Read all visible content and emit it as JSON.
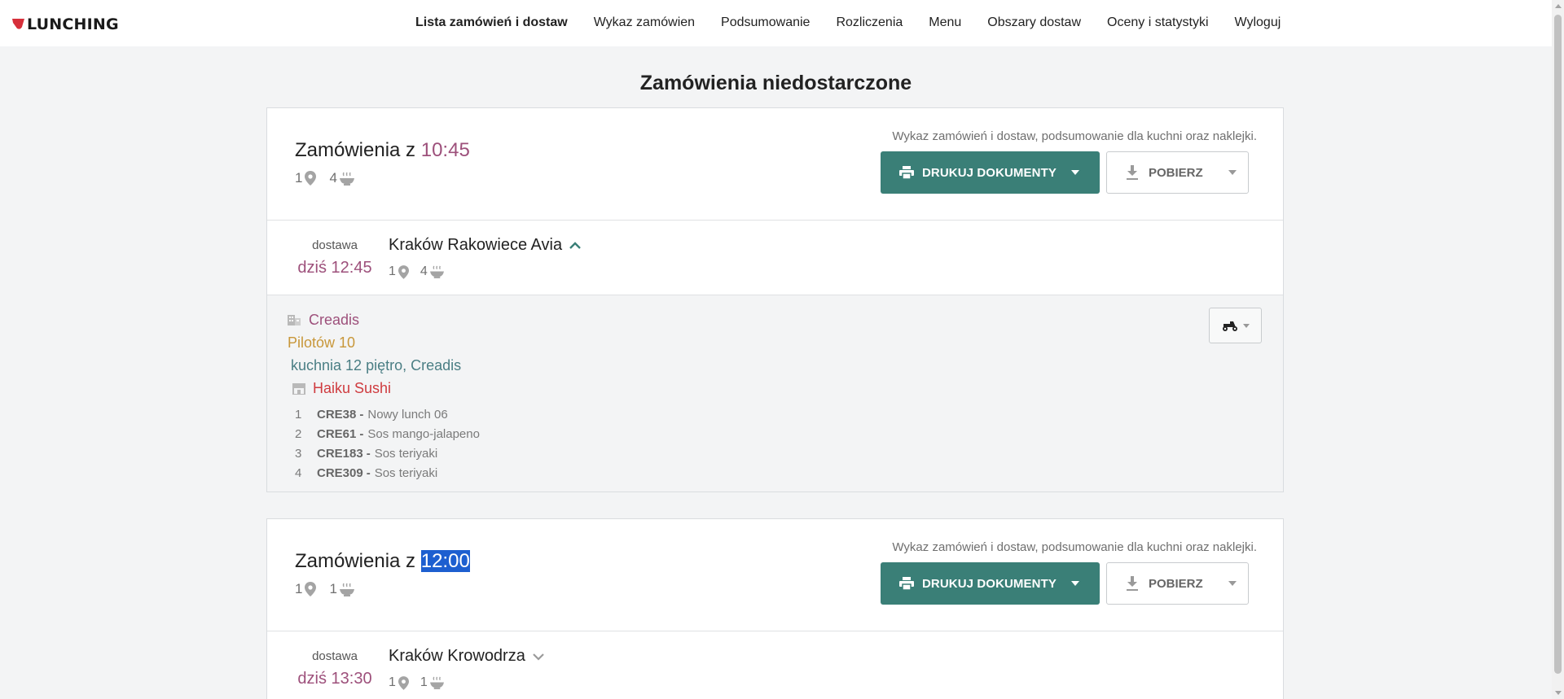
{
  "brand": {
    "logo_text": "LUNCHING",
    "logo_color": "#d62f3a"
  },
  "nav": {
    "items": [
      {
        "label": "Lista zamówień i dostaw",
        "active": true
      },
      {
        "label": "Wykaz zamówien",
        "active": false
      },
      {
        "label": "Podsumowanie",
        "active": false
      },
      {
        "label": "Rozliczenia",
        "active": false
      },
      {
        "label": "Menu",
        "active": false
      },
      {
        "label": "Obszary dostaw",
        "active": false
      },
      {
        "label": "Oceny i statystyki",
        "active": false
      },
      {
        "label": "Wyloguj",
        "active": false
      }
    ]
  },
  "page": {
    "title": "Zamówienia niedostarczone"
  },
  "sections": [
    {
      "title_prefix": "Zamówienia z",
      "time": "10:45",
      "time_selected": false,
      "locations_count": "1",
      "meals_count": "4",
      "info": "Wykaz zamówień i dostaw, podsumowanie dla kuchni oraz naklejki.",
      "print_label": "DRUKUJ DOKUMENTY",
      "download_label": "POBIERZ",
      "delivery": {
        "label": "dostawa",
        "time": "dziś 12:45",
        "place": "Kraków Rakowiece Avia",
        "expanded": true,
        "locations_count": "1",
        "meals_count": "4",
        "company": "Creadis",
        "street": "Pilotów 10",
        "note": "kuchnia 12 piętro, Creadis",
        "restaurant": "Haiku Sushi",
        "items": [
          {
            "no": "1",
            "code": "CRE38",
            "name": "Nowy lunch 06"
          },
          {
            "no": "2",
            "code": "CRE61",
            "name": "Sos mango-jalapeno"
          },
          {
            "no": "3",
            "code": "CRE183",
            "name": "Sos teriyaki"
          },
          {
            "no": "4",
            "code": "CRE309",
            "name": "Sos teriyaki"
          }
        ]
      }
    },
    {
      "title_prefix": "Zamówienia z",
      "time": "12:00",
      "time_selected": true,
      "locations_count": "1",
      "meals_count": "1",
      "info": "Wykaz zamówień i dostaw, podsumowanie dla kuchni oraz naklejki.",
      "print_label": "DRUKUJ DOKUMENTY",
      "download_label": "POBIERZ",
      "delivery": {
        "label": "dostawa",
        "time": "dziś 13:30",
        "place": "Kraków Krowodrza",
        "expanded": false,
        "locations_count": "1",
        "meals_count": "1"
      }
    }
  ],
  "colors": {
    "accent_green": "#3a7f77",
    "time_purple": "#9d507b",
    "street_gold": "#c8973a",
    "note_teal": "#4a7e84",
    "restaurant_red": "#cf3b3f",
    "selection_blue": "#1d5fd0"
  }
}
